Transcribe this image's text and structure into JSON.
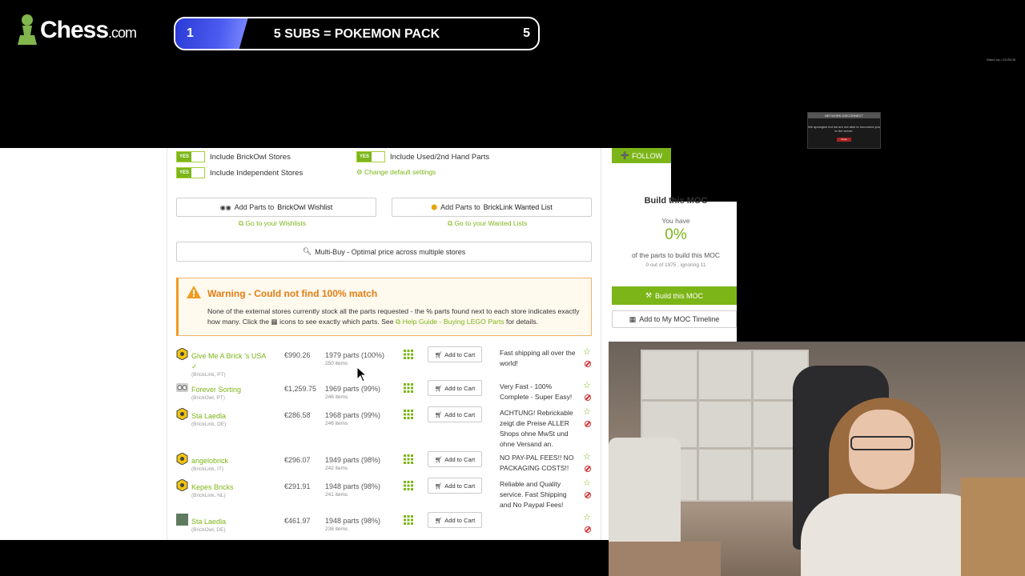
{
  "overlay": {
    "brand": "Chess",
    "brand_suffix": ".com",
    "goal": {
      "current": "1",
      "label": "5 SUBS = POKEMON PACK",
      "max": "5",
      "progress_fraction": 0.2
    },
    "corner_text": "Stand Up • 03:25:08"
  },
  "options": {
    "yes_label": "YES",
    "brickowl_stores": "Include BrickOwl Stores",
    "independent_stores": "Include Independent Stores",
    "used_parts": "Include Used/2nd Hand Parts",
    "change_defaults": "Change default settings"
  },
  "wishlist": {
    "brickowl_btn_prefix": "Add Parts to ",
    "brickowl_btn_bold": "BrickOwl Wishlist",
    "brickowl_link": "Go to your Wishlists",
    "bricklink_btn_prefix": "Add Parts to ",
    "bricklink_btn_bold": "BrickLink Wanted List",
    "bricklink_link": "Go to your Wanted Lists",
    "multibuy": "Multi-Buy - Optimal price across multiple stores"
  },
  "warning": {
    "title": "Warning - Could not find 100% match",
    "body_1": "None of the external stores currently stock all the parts requested - the % parts found next to each store indicates exactly how many. Click the ",
    "body_2": " icons to see exactly which parts. See ",
    "help_link": "Help Guide - Buying LEGO Parts",
    "body_3": " for details."
  },
  "stores": [
    {
      "name": "Give Me A Brick ’s USA ✓",
      "source": "(BrickLink, PT)",
      "price": "€990.26",
      "parts": "1979 parts (100%)",
      "items": "250 items",
      "note": "Fast shipping all over the world!",
      "logo": "bricklink"
    },
    {
      "name": "Forever Sorting",
      "source": "(BrickOwl, PT)",
      "price": "€1,259.75",
      "parts": "1969 parts (99%)",
      "items": "246 items",
      "note": "Very Fast - 100% Complete - Super Easy!",
      "logo": "brickowl"
    },
    {
      "name": "Sta Laedla",
      "source": "(BrickLink, DE)",
      "price": "€286.58",
      "parts": "1968 parts (99%)",
      "items": "246 items",
      "note": "ACHTUNG! Rebrickable zeigt die Preise ALLER Shops ohne MwSt und ohne Versand an.",
      "logo": "bricklink"
    },
    {
      "name": "angelobrick",
      "source": "(BrickLink, IT)",
      "price": "€296.07",
      "parts": "1949 parts (98%)",
      "items": "242 items",
      "note": "NO PAY-PAL FEES!! NO PACKAGING COSTS!!",
      "logo": "bricklink"
    },
    {
      "name": "Kepes Bricks",
      "source": "(BrickLink, NL)",
      "price": "€291.91",
      "parts": "1948 parts (98%)",
      "items": "241 items",
      "note": "Reliable and Quality service. Fast Shipping and No Paypal Fees!",
      "logo": "bricklink"
    },
    {
      "name": "Sta Laedla",
      "source": "(BrickOwl, DE)",
      "price": "€461.97",
      "parts": "1948 parts (98%)",
      "items": "238 items",
      "note": "",
      "logo": "brickowl-green"
    }
  ],
  "cart_label": "Add to Cart",
  "sidebar": {
    "follow": "FOLLOW",
    "build_title": "Build this MOC",
    "you_have": "You have",
    "percent": "0%",
    "of_parts": "of the parts to build this MOC",
    "out_of": "0 out of 1975 , ignoring 11",
    "build_btn": "Build this MOC",
    "timeline_btn": "Add to My MOC Timeline"
  },
  "popup": {
    "title": "NETWORK DISCONNECT",
    "text": "We apologize but we are not able to reconnect you to the server.",
    "button": "Close"
  },
  "colors": {
    "accent": "#7cb518",
    "warning": "#e37d12",
    "goal": "#3c4de6"
  }
}
